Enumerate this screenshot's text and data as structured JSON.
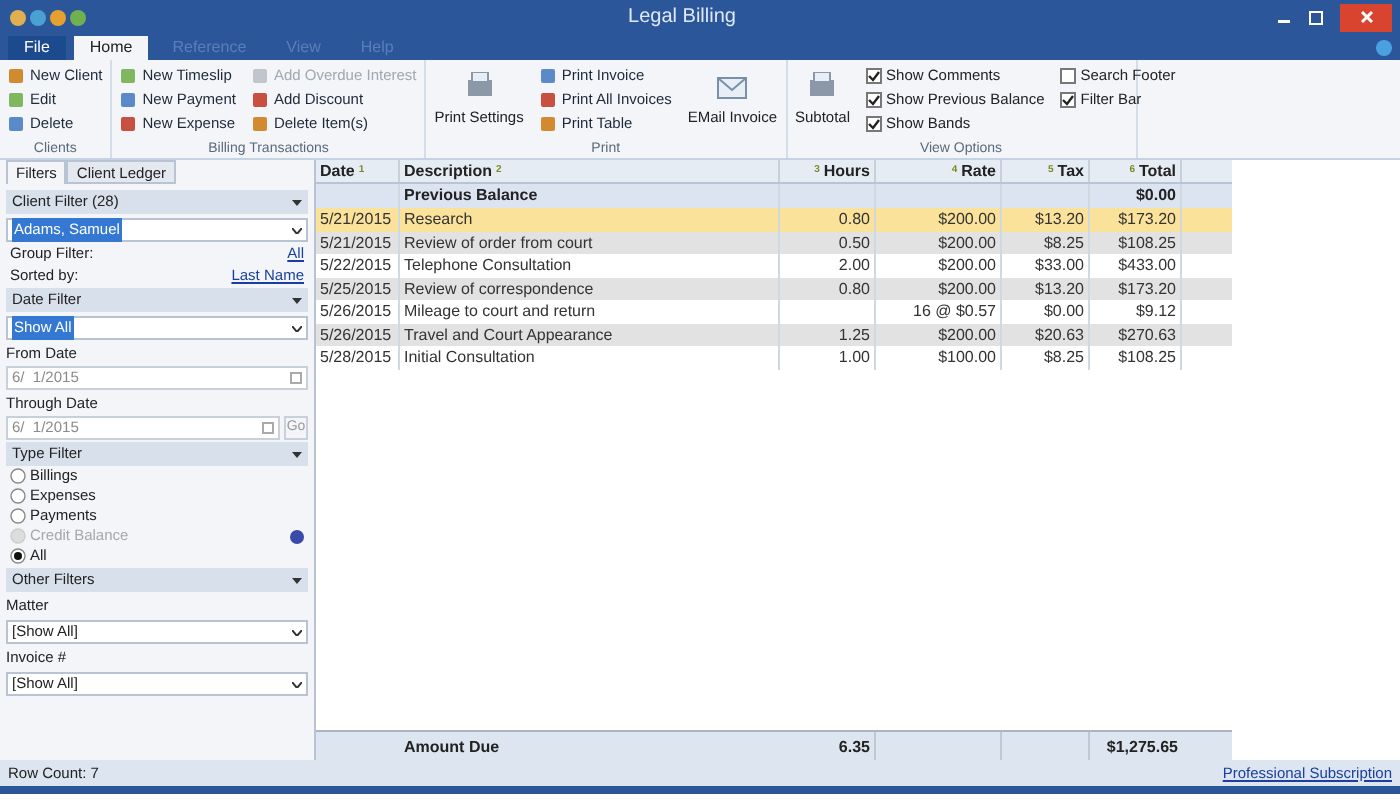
{
  "window": {
    "title": "Legal Billing"
  },
  "menu_tabs": [
    {
      "label": "File",
      "kind": "file",
      "selected": false
    },
    {
      "label": "Home",
      "kind": "tab",
      "selected": true
    },
    {
      "label": "Reference",
      "kind": "tab",
      "selected": false
    },
    {
      "label": "View",
      "kind": "tab",
      "selected": false
    },
    {
      "label": "Help",
      "kind": "tab",
      "selected": false
    }
  ],
  "ribbon_groups": [
    {
      "title": "Clients",
      "columns": [
        [
          {
            "label": "New Client",
            "disabled": false
          },
          {
            "label": "Edit",
            "disabled": false
          },
          {
            "label": "Delete",
            "disabled": false
          }
        ]
      ]
    },
    {
      "title": "Billing Transactions",
      "columns": [
        [
          {
            "label": "New Timeslip",
            "disabled": false
          },
          {
            "label": "New Payment",
            "disabled": false
          },
          {
            "label": "New Expense",
            "disabled": false
          }
        ],
        [
          {
            "label": "Add Overdue Interest",
            "disabled": true
          },
          {
            "label": "Add Discount",
            "disabled": false
          },
          {
            "label": "Delete Item(s)",
            "disabled": false
          }
        ]
      ]
    },
    {
      "title": "Print",
      "big": [
        "Print Settings"
      ],
      "columns": [
        [
          {
            "label": "Print Invoice",
            "disabled": false
          },
          {
            "label": "Print All Invoices",
            "disabled": false
          },
          {
            "label": "Print Table",
            "disabled": false
          }
        ]
      ],
      "big_after": [
        "EMail Invoice"
      ]
    },
    {
      "title": "View Options",
      "big": [
        "Subtotal"
      ],
      "checks": [
        [
          {
            "label": "Show Comments",
            "checked": true
          },
          {
            "label": "Show Previous Balance",
            "checked": true
          },
          {
            "label": "Show Bands",
            "checked": true
          }
        ],
        [
          {
            "label": "Search Footer",
            "checked": false
          },
          {
            "label": "Filter Bar",
            "checked": true
          }
        ]
      ]
    }
  ],
  "side_tabs": [
    {
      "label": "Filters",
      "selected": true
    },
    {
      "label": "Client Ledger",
      "selected": false
    }
  ],
  "client_filter": {
    "header": "Client Filter (28)",
    "value": "Adams, Samuel",
    "group_label": "Group Filter:",
    "group_value": "All",
    "sort_label": "Sorted by:",
    "sort_value": "Last Name"
  },
  "date_filter": {
    "header": "Date Filter",
    "value": "Show All",
    "from_label": "From Date",
    "from": "6/  1/2015",
    "through_label": "Through Date",
    "through": "6/  1/2015",
    "go": "Go"
  },
  "type_filter": {
    "header": "Type Filter",
    "options": [
      {
        "label": "Billings",
        "selected": false,
        "disabled": false
      },
      {
        "label": "Expenses",
        "selected": false,
        "disabled": false
      },
      {
        "label": "Payments",
        "selected": false,
        "disabled": false
      },
      {
        "label": "Credit Balance",
        "selected": false,
        "disabled": true
      },
      {
        "label": "All",
        "selected": true,
        "disabled": false
      }
    ]
  },
  "other_filters": {
    "header": "Other Filters",
    "matter_label": "Matter",
    "matter": "[Show All]",
    "invoice_label": "Invoice #",
    "invoice": "[Show All]"
  },
  "table": {
    "columns": [
      {
        "label": "Date",
        "num": "1"
      },
      {
        "label": "Description",
        "num": "2"
      },
      {
        "label": "Hours",
        "num": "3"
      },
      {
        "label": "Rate",
        "num": "4"
      },
      {
        "label": "Tax",
        "num": "5"
      },
      {
        "label": "Total",
        "num": "6"
      }
    ],
    "previous": {
      "label": "Previous Balance",
      "total": "$0.00"
    },
    "rows": [
      {
        "cells": [
          "5/21/2015",
          "Research",
          "0.80",
          "$200.00",
          "$13.20",
          "$173.20"
        ],
        "selected": true
      },
      {
        "cells": [
          "5/21/2015",
          "Review of order from court",
          "0.50",
          "$200.00",
          "$8.25",
          "$108.25"
        ],
        "selected": false
      },
      {
        "cells": [
          "5/22/2015",
          "Telephone Consultation",
          "2.00",
          "$200.00",
          "$33.00",
          "$433.00"
        ],
        "selected": false
      },
      {
        "cells": [
          "5/25/2015",
          "Review of correspondence",
          "0.80",
          "$200.00",
          "$13.20",
          "$173.20"
        ],
        "selected": false
      },
      {
        "cells": [
          "5/26/2015",
          "Mileage to court and return",
          "",
          "16 @ $0.57",
          "$0.00",
          "$9.12"
        ],
        "selected": false
      },
      {
        "cells": [
          "5/26/2015",
          "Travel and Court Appearance",
          "1.25",
          "$200.00",
          "$20.63",
          "$270.63"
        ],
        "selected": false
      },
      {
        "cells": [
          "5/28/2015",
          "Initial Consultation",
          "1.00",
          "$100.00",
          "$8.25",
          "$108.25"
        ],
        "selected": false
      }
    ],
    "footer": {
      "label": "Amount Due",
      "hours": "6.35",
      "total": "$1,275.65"
    }
  },
  "status_bar": {
    "row_count": "Row Count: 7",
    "link": "Professional Subscription"
  }
}
